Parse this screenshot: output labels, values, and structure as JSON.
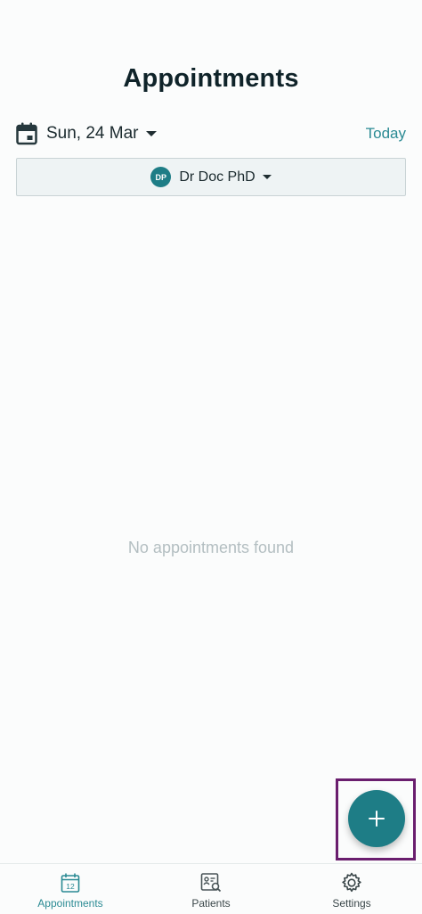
{
  "header": {
    "title": "Appointments"
  },
  "date_bar": {
    "selected_date": "Sun, 24 Mar",
    "today_label": "Today"
  },
  "doctor_filter": {
    "initials": "DP",
    "name": "Dr Doc PhD"
  },
  "main": {
    "empty_message": "No appointments found"
  },
  "fab": {
    "icon": "plus-icon"
  },
  "bottom_nav": {
    "items": [
      {
        "label": "Appointments",
        "icon": "calendar-12-icon",
        "active": true
      },
      {
        "label": "Patients",
        "icon": "patient-search-icon",
        "active": false
      },
      {
        "label": "Settings",
        "icon": "gear-icon",
        "active": false
      }
    ]
  },
  "colors": {
    "accent": "#1e7d86",
    "link": "#2a8a93",
    "highlight_box": "#6a1e6e",
    "background": "#fbfcfc",
    "muted_text": "#b3bec1"
  }
}
